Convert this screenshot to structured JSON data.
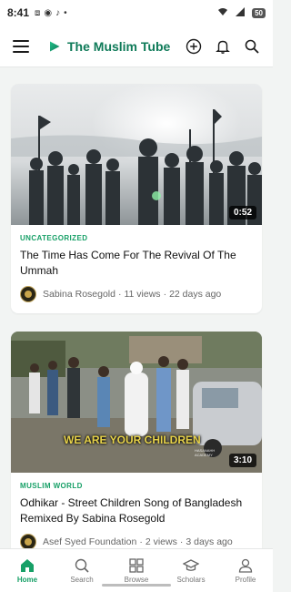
{
  "status_bar": {
    "time": "8:41",
    "battery": "50"
  },
  "app_bar": {
    "title": "The Muslim Tube"
  },
  "videos": [
    {
      "category": "UNCATEGORIZED",
      "title": "The Time Has Come For The Revival Of The Ummah",
      "author": "Sabina Rosegold",
      "views": "11 views",
      "age": "22 days ago",
      "duration": "0:52",
      "thumb_icon": "crowd-silhouette-image"
    },
    {
      "category": "MUSLIM WORLD",
      "title": "Odhikar - Street Children Song of Bangladesh Remixed By Sabina Rosegold",
      "author": "Asef Syed Foundation",
      "views": "2 views",
      "age": "3 days ago",
      "duration": "3:10",
      "caption": "WE ARE YOUR CHILDREN",
      "watermark": "HASANAHH ACADEMY",
      "thumb_icon": "street-scene-image"
    }
  ],
  "separator": "·",
  "bottom_nav": {
    "items": [
      {
        "label": "Home",
        "icon": "home-icon",
        "active": true
      },
      {
        "label": "Search",
        "icon": "search-icon",
        "active": false
      },
      {
        "label": "Browse",
        "icon": "grid-icon",
        "active": false
      },
      {
        "label": "Scholars",
        "icon": "graduation-cap-icon",
        "active": false
      },
      {
        "label": "Profile",
        "icon": "person-icon",
        "active": false
      }
    ]
  },
  "colors": {
    "accent": "#17a067",
    "brand": "#0e7a58"
  }
}
